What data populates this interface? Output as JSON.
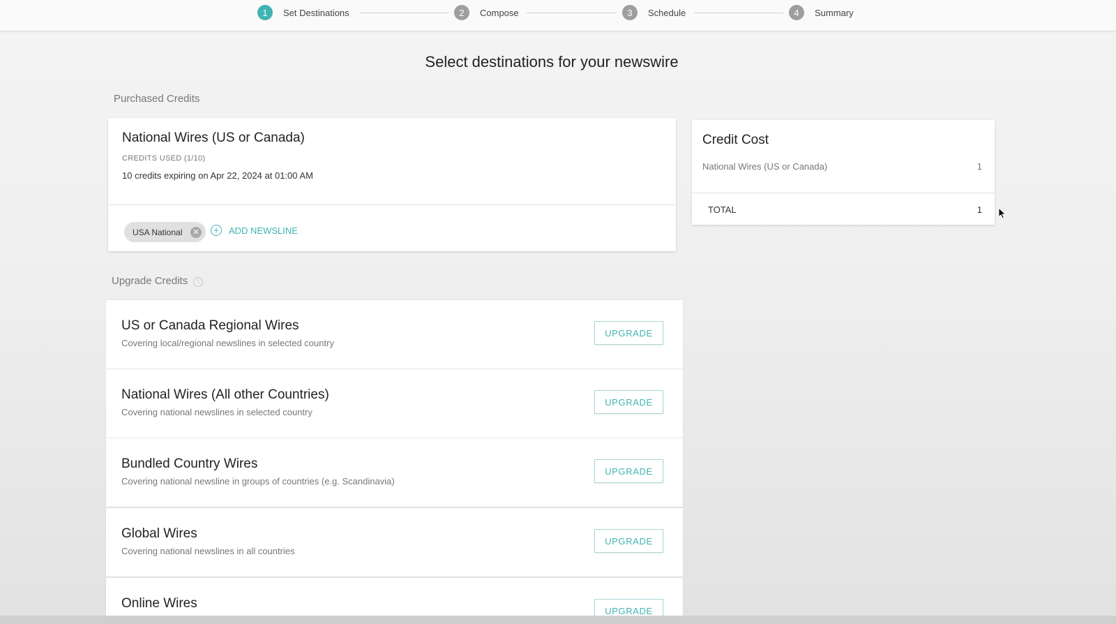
{
  "stepper": {
    "steps": [
      {
        "num": "1",
        "label": "Set Destinations"
      },
      {
        "num": "2",
        "label": "Compose"
      },
      {
        "num": "3",
        "label": "Schedule"
      },
      {
        "num": "4",
        "label": "Summary"
      }
    ],
    "active_step": 1
  },
  "page_title": "Select destinations for your newswire",
  "purchased": {
    "section_label": "Purchased Credits",
    "title": "National Wires (US or Canada)",
    "credits_used": "CREDITS USED (1/10)",
    "expiry": "10 credits expiring on Apr 22, 2024 at 01:00 AM",
    "chip_label": "USA National",
    "add_newsline": "ADD NEWSLINE"
  },
  "credit_cost": {
    "title": "Credit Cost",
    "line_label": "National Wires (US or Canada)",
    "line_value": "1",
    "total_label": "TOTAL",
    "total_value": "1"
  },
  "upgrade": {
    "section_label": "Upgrade Credits",
    "button_label": "UPGRADE",
    "items": [
      {
        "title": "US or Canada Regional Wires",
        "desc": "Covering local/regional newslines in selected country"
      },
      {
        "title": "National Wires (All other Countries)",
        "desc": "Covering national newslines in selected country"
      },
      {
        "title": "Bundled Country Wires",
        "desc": "Covering national newsline in groups of countries (e.g. Scandinavia)"
      },
      {
        "title": "Global Wires",
        "desc": "Covering national newslines in all countries"
      },
      {
        "title": "Online Wires",
        "desc": ""
      }
    ]
  },
  "colors": {
    "accent": "#40b3b3",
    "inactive_step": "#9e9e9e"
  },
  "icons": {
    "remove_chip": "close-circle-icon",
    "add": "plus-circle-icon",
    "info": "info-icon",
    "cursor": "mouse-pointer-icon"
  }
}
